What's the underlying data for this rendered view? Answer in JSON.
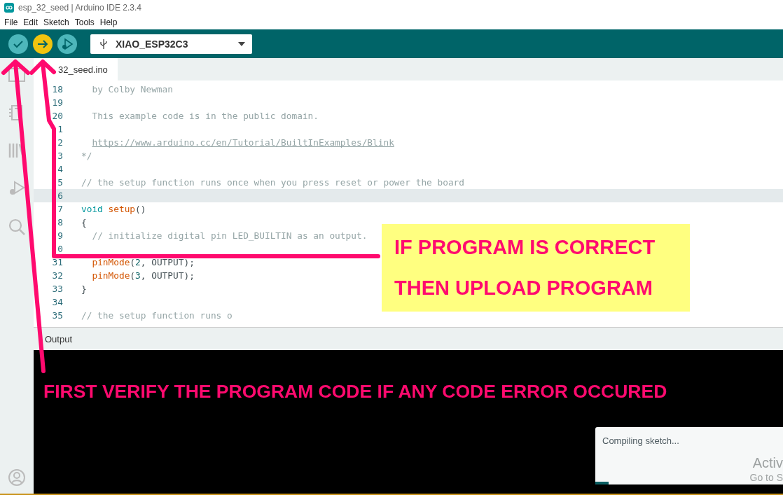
{
  "window": {
    "title": "esp_32_seed | Arduino IDE 2.3.4"
  },
  "menu": [
    "File",
    "Edit",
    "Sketch",
    "Tools",
    "Help"
  ],
  "toolbar": {
    "buttons": [
      {
        "kind": "verify"
      },
      {
        "kind": "upload"
      },
      {
        "kind": "debug"
      }
    ],
    "board": "XIAO_ESP32C3"
  },
  "tabs": [
    {
      "label": "32_seed.ino",
      "selected": true
    }
  ],
  "editor": {
    "lines": [
      {
        "number": "18",
        "current": false,
        "tokens": [
          {
            "text": "  by Colby Newman",
            "kind": "comment"
          }
        ]
      },
      {
        "number": "19",
        "current": false
      },
      {
        "number": "20",
        "current": false,
        "tokens": [
          {
            "text": "  This example code is in the public domain.",
            "kind": "comment"
          }
        ]
      },
      {
        "number": "1",
        "current": false
      },
      {
        "number": "2",
        "current": false,
        "tokens": [
          {
            "text": "  https://www.arduino.cc/en/Tutorial/BuiltInExamples/Blink",
            "kind": "link"
          }
        ]
      },
      {
        "number": "3",
        "current": false,
        "tokens": [
          {
            "text": "*/",
            "kind": "comment"
          }
        ]
      },
      {
        "number": "4",
        "current": false
      },
      {
        "number": "5",
        "current": false,
        "tokens": [
          {
            "text": "// the setup function runs once when you press reset or power the board",
            "kind": "comment"
          }
        ]
      },
      {
        "number": "6",
        "current": true
      },
      {
        "number": "7",
        "current": false,
        "tokens": [
          {
            "text": "void",
            "kind": "keyword"
          },
          {
            "text": " setup",
            "kind": "function"
          },
          {
            "text": "()",
            "kind": "plain"
          }
        ]
      },
      {
        "number": "8",
        "current": false,
        "tokens": [
          {
            "text": "{",
            "kind": "plain"
          }
        ]
      },
      {
        "number": "9",
        "current": false,
        "tokens": [
          {
            "text": "  // initialize digital pin LED_BUILTIN as an output.",
            "kind": "comment"
          }
        ]
      },
      {
        "number": "0",
        "current": false
      },
      {
        "number": "31",
        "current": false,
        "tokens": [
          {
            "text": "  pinMode",
            "kind": "function"
          },
          {
            "text": "(",
            "kind": "plain"
          },
          {
            "text": "2",
            "kind": "number"
          },
          {
            "text": ", OUTPUT);",
            "kind": "plain"
          }
        ]
      },
      {
        "number": "32",
        "current": false,
        "tokens": [
          {
            "text": "  pinMode",
            "kind": "function"
          },
          {
            "text": "(",
            "kind": "plain"
          },
          {
            "text": "3",
            "kind": "number"
          },
          {
            "text": ", OUTPUT);",
            "kind": "plain"
          }
        ]
      },
      {
        "number": "33",
        "current": false,
        "tokens": [
          {
            "text": "}",
            "kind": "plain"
          }
        ]
      },
      {
        "number": "34",
        "current": false
      },
      {
        "number": "35",
        "current": false,
        "tokens": [
          {
            "text": "// the setup function runs o",
            "kind": "comment"
          }
        ]
      }
    ]
  },
  "output": {
    "title": "Output"
  },
  "notification": {
    "message": "Compiling sketch...",
    "level": 0.07
  },
  "os_watermark": [
    "Activ",
    "Go to S"
  ],
  "annotations": [
    {
      "kind": "callout",
      "lines": [
        "IF PROGRAM IS CORRECT",
        "THEN UPLOAD PROGRAM"
      ]
    },
    {
      "kind": "caption",
      "text": "FIRST VERIFY THE PROGRAM CODE IF ANY CODE ERROR OCCURED"
    }
  ]
}
